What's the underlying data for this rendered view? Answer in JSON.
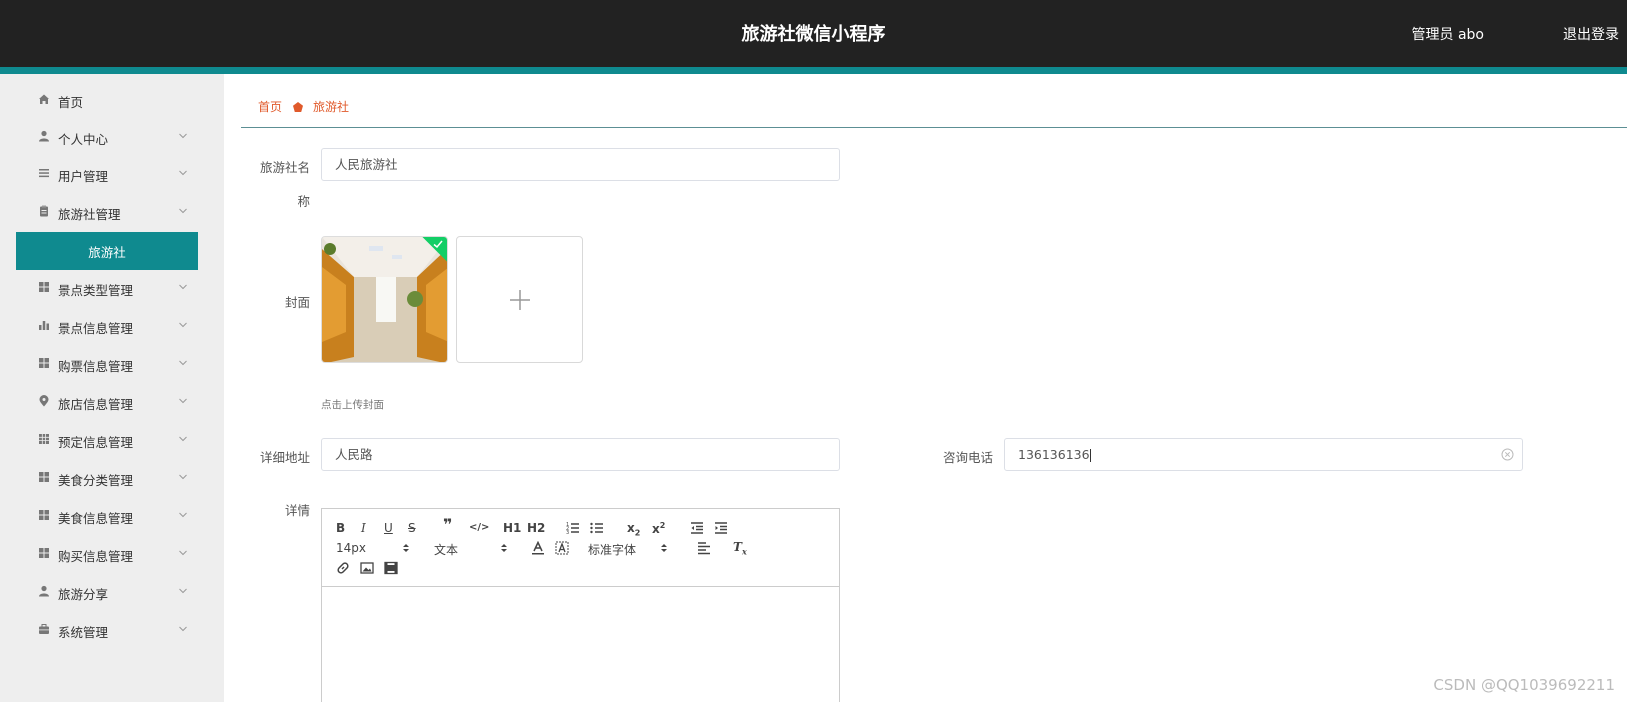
{
  "header": {
    "title": "旅游社微信小程序",
    "user": "管理员 abo",
    "logout": "退出登录"
  },
  "colors": {
    "accent": "#0f8a8f",
    "header_bg": "#222222",
    "breadcrumb": "#e05a2b",
    "success": "#13ce66"
  },
  "sidebar": {
    "items": [
      {
        "label": "首页",
        "icon": "home-icon"
      },
      {
        "label": "个人中心",
        "icon": "user-icon"
      },
      {
        "label": "用户管理",
        "icon": "list-icon"
      },
      {
        "label": "旅游社管理",
        "icon": "clipboard-icon"
      },
      {
        "label": "旅游社",
        "icon": ""
      },
      {
        "label": "景点类型管理",
        "icon": "grid-icon"
      },
      {
        "label": "景点信息管理",
        "icon": "bar-chart-icon"
      },
      {
        "label": "购票信息管理",
        "icon": "grid-icon"
      },
      {
        "label": "旅店信息管理",
        "icon": "location-icon"
      },
      {
        "label": "预定信息管理",
        "icon": "table-icon"
      },
      {
        "label": "美食分类管理",
        "icon": "grid-icon"
      },
      {
        "label": "美食信息管理",
        "icon": "grid-icon"
      },
      {
        "label": "购买信息管理",
        "icon": "grid-icon"
      },
      {
        "label": "旅游分享",
        "icon": "user-icon"
      },
      {
        "label": "系统管理",
        "icon": "briefcase-icon"
      }
    ]
  },
  "breadcrumb": {
    "home": "首页",
    "current": "旅游社"
  },
  "form": {
    "name_label_1": "旅游社名",
    "name_label_2": "称",
    "name_value": "人民旅游社",
    "cover_label": "封面",
    "cover_tip": "点击上传封面",
    "address_label": "详细地址",
    "address_value": "人民路",
    "phone_label": "咨询电话",
    "phone_value": "136136136",
    "detail_label": "详情"
  },
  "editor": {
    "font_size": "14px",
    "block_type": "文本",
    "font_family": "标准字体",
    "h1": "H1",
    "h2": "H2"
  },
  "watermark": "CSDN @QQ1039692211"
}
